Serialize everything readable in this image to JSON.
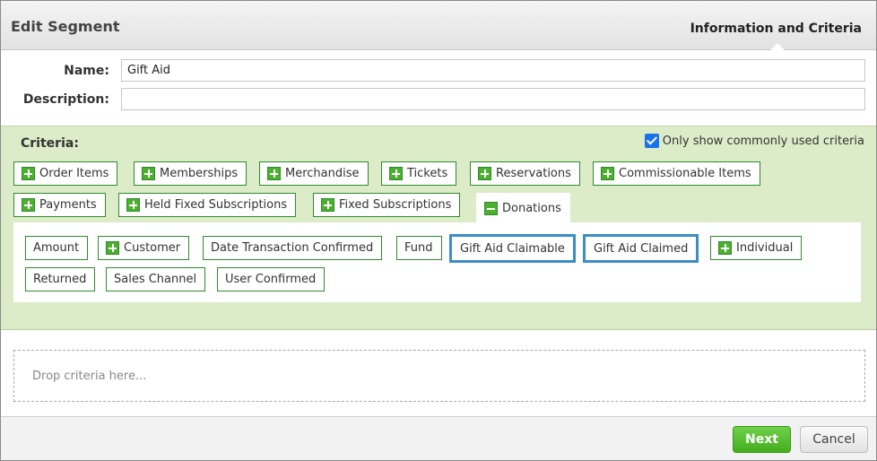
{
  "header": {
    "title": "Edit Segment",
    "step": "Information and Criteria"
  },
  "form": {
    "name_label": "Name:",
    "name_value": "Gift Aid",
    "description_label": "Description:",
    "description_value": ""
  },
  "criteria": {
    "title": "Criteria:",
    "only_common_label": "Only show commonly used criteria",
    "only_common_checked": true,
    "categories": [
      {
        "label": "Order Items",
        "expanded": false
      },
      {
        "label": "Memberships",
        "expanded": false
      },
      {
        "label": "Merchandise",
        "expanded": false
      },
      {
        "label": "Tickets",
        "expanded": false
      },
      {
        "label": "Reservations",
        "expanded": false
      },
      {
        "label": "Commissionable Items",
        "expanded": false
      },
      {
        "label": "Payments",
        "expanded": false
      },
      {
        "label": "Held Fixed Subscriptions",
        "expanded": false
      },
      {
        "label": "Fixed Subscriptions",
        "expanded": false
      },
      {
        "label": "Donations",
        "expanded": true
      }
    ],
    "fields": [
      {
        "label": "Amount",
        "expandable": false,
        "selected": false
      },
      {
        "label": "Customer",
        "expandable": true,
        "selected": false
      },
      {
        "label": "Date Transaction Confirmed",
        "expandable": false,
        "selected": false
      },
      {
        "label": "Fund",
        "expandable": false,
        "selected": false
      },
      {
        "label": "Gift Aid Claimable",
        "expandable": false,
        "selected": true
      },
      {
        "label": "Gift Aid Claimed",
        "expandable": false,
        "selected": true
      },
      {
        "label": "Individual",
        "expandable": true,
        "selected": false
      },
      {
        "label": "Returned",
        "expandable": false,
        "selected": false
      },
      {
        "label": "Sales Channel",
        "expandable": false,
        "selected": false
      },
      {
        "label": "User Confirmed",
        "expandable": false,
        "selected": false
      }
    ]
  },
  "drop_zone": {
    "placeholder": "Drop criteria here..."
  },
  "footer": {
    "next_label": "Next",
    "cancel_label": "Cancel"
  },
  "colors": {
    "criteria_bg": "#dcebc8",
    "tag_border": "#2e8b2e",
    "selected_border": "#3a8ec4",
    "next_button": "#44ad1e",
    "checkbox": "#1a73e8"
  }
}
